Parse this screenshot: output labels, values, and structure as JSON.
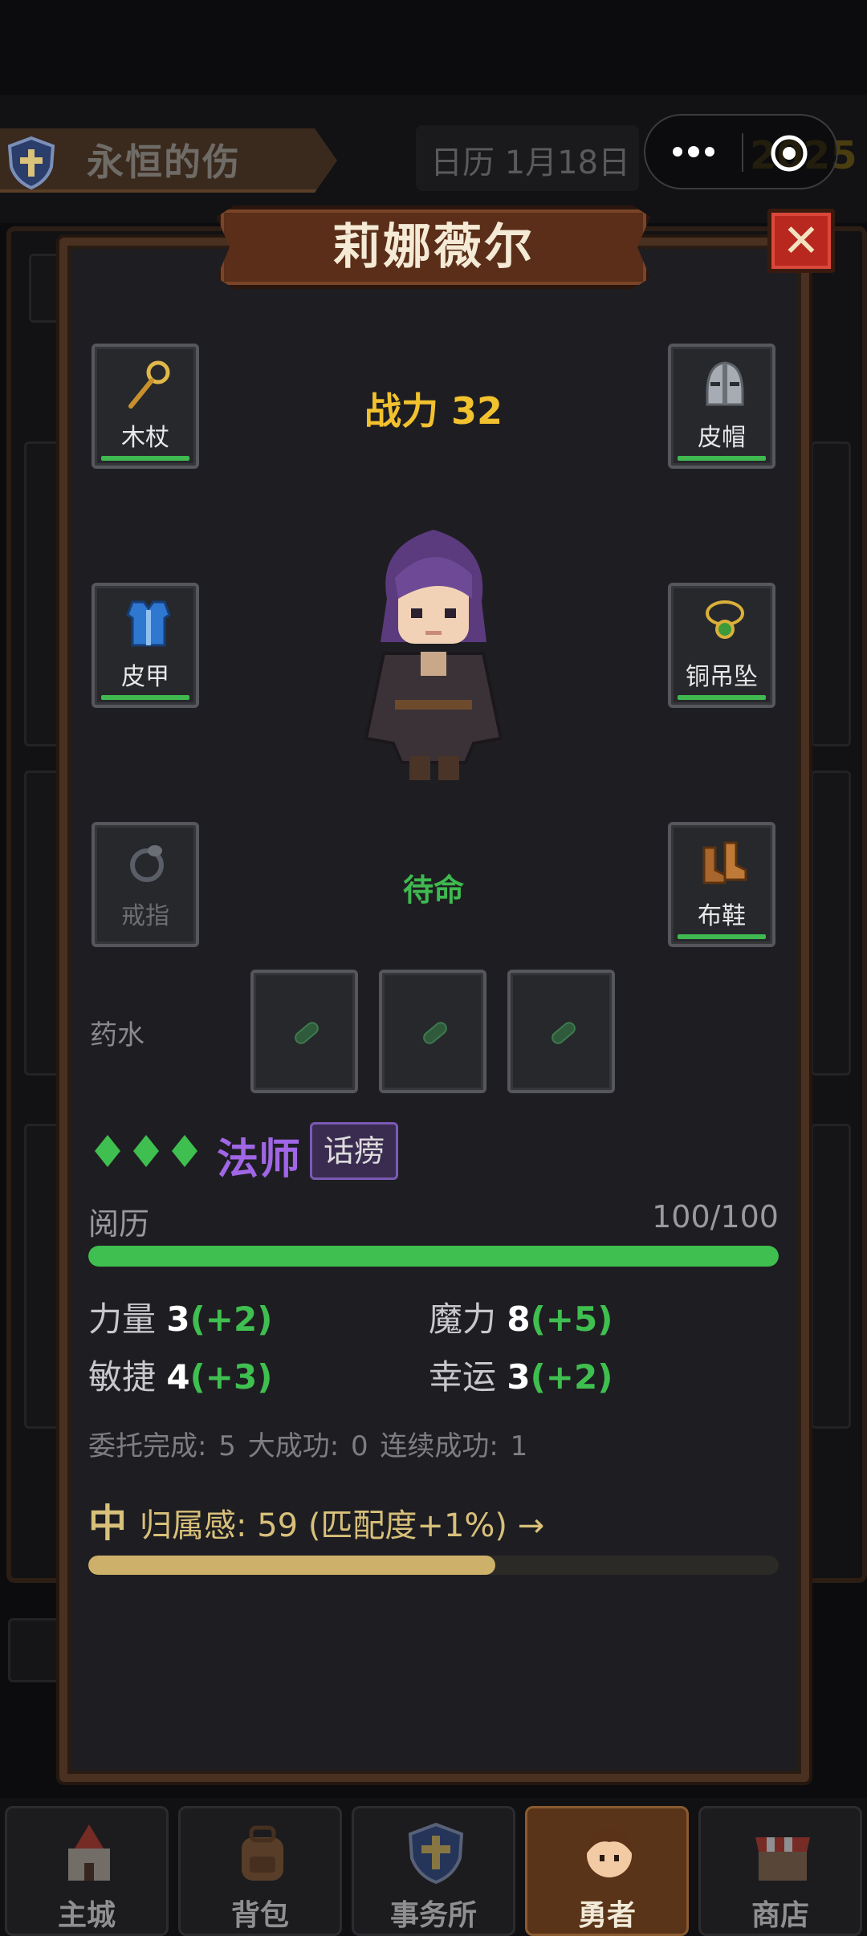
{
  "header": {
    "guild_name": "永恒的伤",
    "date": "日历 1月18日",
    "gold": "2025"
  },
  "modal": {
    "title": "莉娜薇尔",
    "power": "战力 32",
    "status": "待命",
    "equipment": {
      "weapon": "木杖",
      "helmet": "皮帽",
      "armor": "皮甲",
      "necklace": "铜吊坠",
      "ring": "戒指",
      "boots": "布鞋"
    },
    "potion_label": "药水",
    "class_name": "法师",
    "trait": "话痨",
    "experience": {
      "label": "阅历",
      "value": "100/100",
      "fraction": 1.0
    },
    "stats": {
      "str_label": "力量",
      "str_value": "3",
      "str_bonus": "(+2)",
      "mag_label": "魔力",
      "mag_value": "8",
      "mag_bonus": "(+5)",
      "agi_label": "敏捷",
      "agi_value": "4",
      "agi_bonus": "(+3)",
      "luk_label": "幸运",
      "luk_value": "3",
      "luk_bonus": "(+2)"
    },
    "records": "委托完成: 5  大成功: 0  连续成功: 1",
    "belonging": {
      "level": "中",
      "text": "归属感: 59 (匹配度+1%) →",
      "fraction": 0.59
    }
  },
  "nav": {
    "home": "主城",
    "bag": "背包",
    "office": "事务所",
    "hero": "勇者",
    "shop": "商店"
  },
  "colors": {
    "accent_gold": "#f2c12e",
    "status_green": "#3fb950",
    "class_purple": "#a066e6"
  }
}
